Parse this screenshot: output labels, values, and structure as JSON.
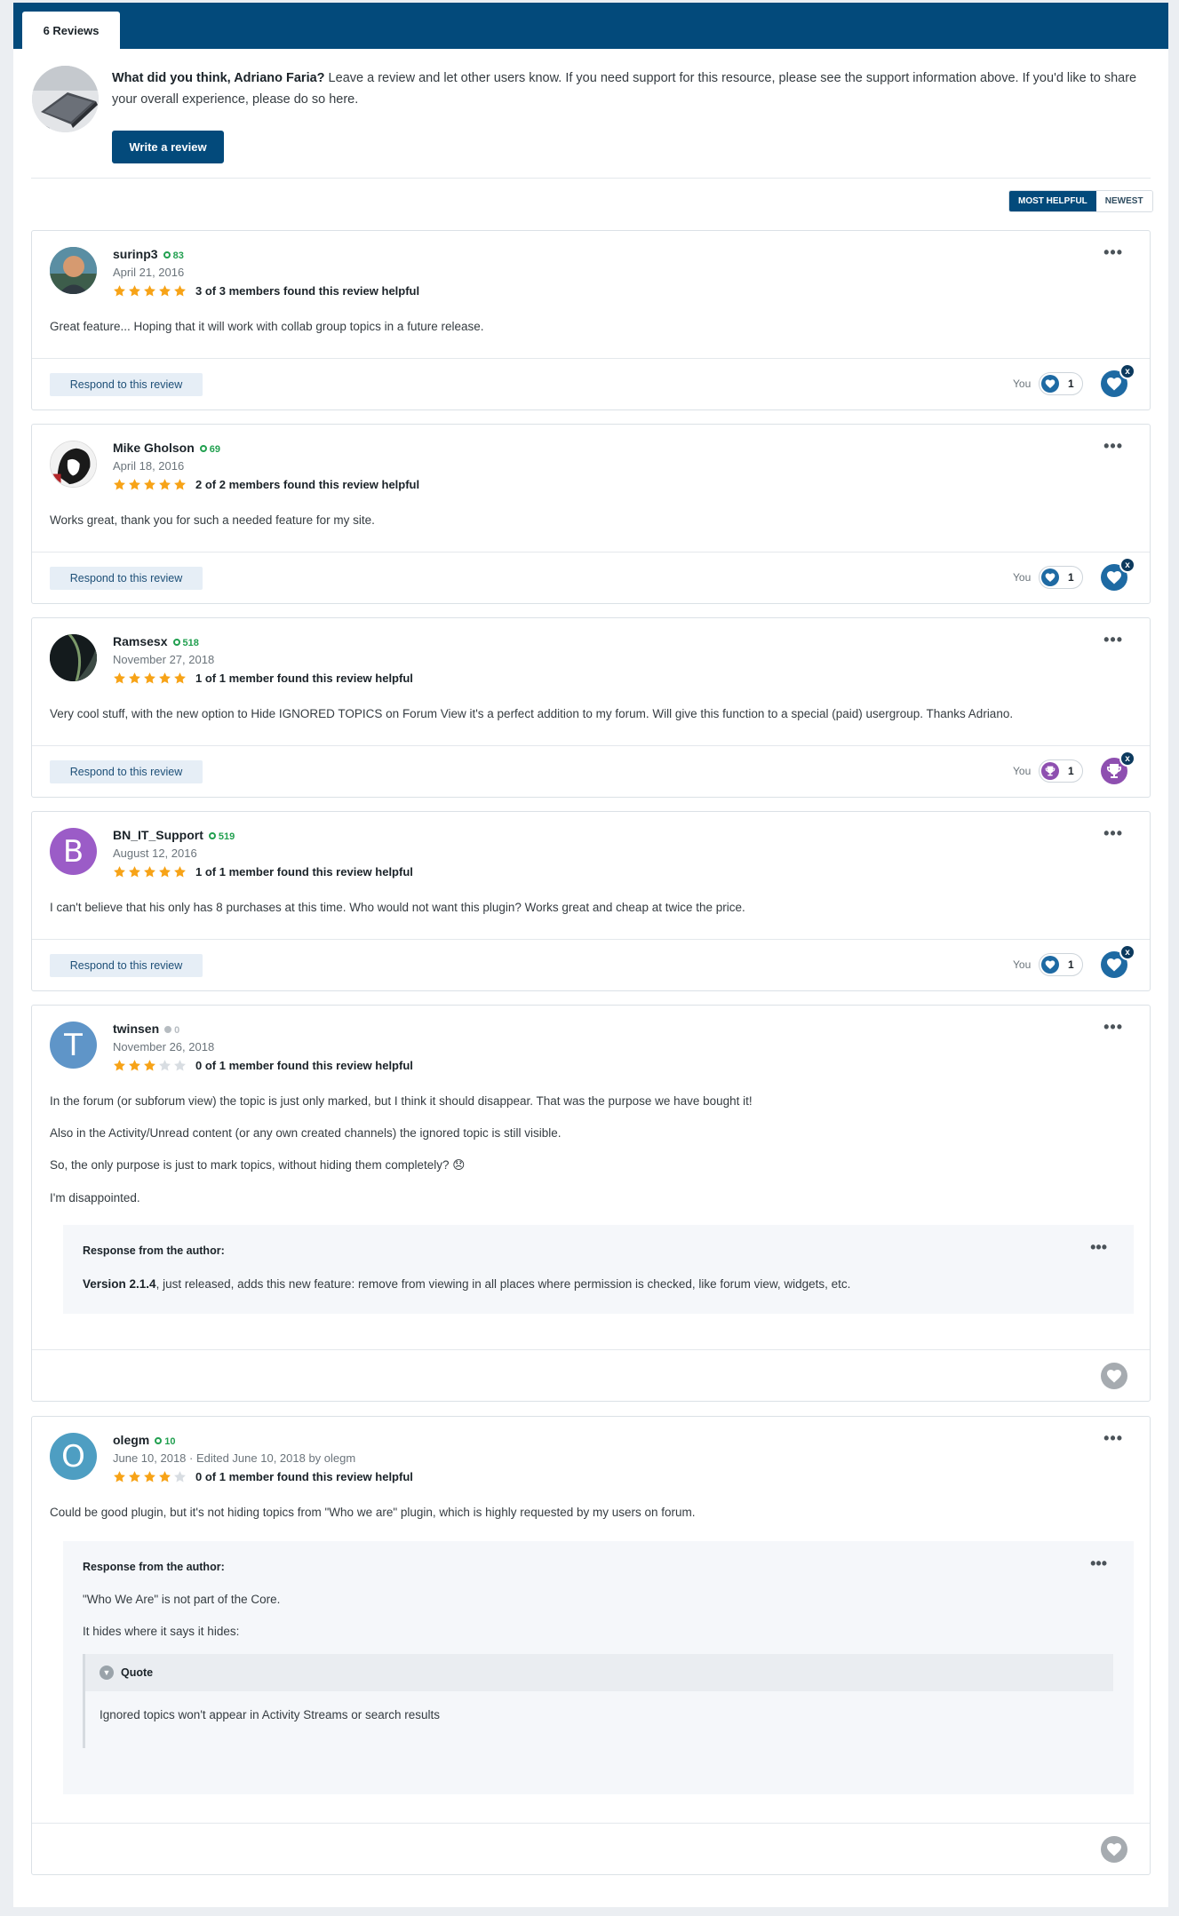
{
  "tab": {
    "label": "6 Reviews"
  },
  "intro": {
    "question": "What did you think, Adriano Faria?",
    "text": " Leave a review and let other users know. If you need support for this resource, please see the support information above. If you'd like to share your overall experience, please do so here.",
    "button": "Write a review"
  },
  "sort": {
    "most_helpful": "Most Helpful",
    "newest": "Newest"
  },
  "common": {
    "respond": "Respond to this review",
    "you": "You",
    "menu": "•••",
    "response_title": "Response from the author:",
    "remove_reaction": "x"
  },
  "reviews": [
    {
      "name": "surinp3",
      "rep": "83",
      "date": "April 21, 2016",
      "rating": 5,
      "helpful": "3 of 3 members found this review helpful",
      "text": "Great feature... Hoping that it will work with collab group topics in a future release.",
      "reaction_count": "1",
      "reaction": "heart"
    },
    {
      "name": "Mike Gholson",
      "rep": "69",
      "date": "April 18, 2016",
      "rating": 5,
      "helpful": "2 of 2 members found this review helpful",
      "text": "Works great, thank you for such a needed feature for my site.",
      "reaction_count": "1",
      "reaction": "heart"
    },
    {
      "name": "Ramsesx",
      "rep": "518",
      "date": "November 27, 2018",
      "rating": 5,
      "helpful": "1 of 1 member found this review helpful",
      "text": "Very cool stuff, with the new option to Hide IGNORED TOPICS on Forum View it's a perfect addition to my forum. Will give this function to a special (paid) usergroup. Thanks Adriano.",
      "reaction_count": "1",
      "reaction": "trophy"
    },
    {
      "name": "BN_IT_Support",
      "rep": "519",
      "date": "August 12, 2016",
      "rating": 5,
      "helpful": "1 of 1 member found this review helpful",
      "initial": "B",
      "text": "I can't believe that his only has 8 purchases at this time. Who would not want this plugin? Works great and cheap at twice the price.",
      "reaction_count": "1",
      "reaction": "heart"
    },
    {
      "name": "twinsen",
      "rep": "0",
      "date": "November 26, 2018",
      "rating": 3,
      "helpful": "0 of 1 member found this review helpful",
      "initial": "T",
      "paragraphs": [
        "In the forum (or subforum view) the topic is just only marked, but I think it should disappear. That was the purpose we have bought it!",
        "Also in the Activity/Unread content (or any own created channels) the ignored topic is still visible.",
        "So, the only purpose is just to mark topics, without hiding them completely? 😞",
        "I'm disappointed."
      ],
      "response_version": "Version 2.1.4",
      "response_text": ", just released, adds this new feature: remove from viewing in all places where permission is checked, like forum view, widgets, etc."
    },
    {
      "name": "olegm",
      "rep": "10",
      "date": "June 10, 2018 · Edited June 10, 2018 by olegm",
      "rating": 4,
      "helpful": "0 of 1 member found this review helpful",
      "initial": "O",
      "text": "Could be good plugin, but it's not hiding topics from  \"Who we are\" plugin, which is highly requested by my users on forum.",
      "response_p1": "\"Who We Are\" is not part of the Core.",
      "response_p2": "It hides where it says it hides:",
      "quote_label": "Quote",
      "quote_text": "Ignored topics won't appear in Activity Streams or search results"
    }
  ],
  "colors": {
    "brand": "#034a7b",
    "star": "#f7a317",
    "heart": "#1e6aa3",
    "trophy": "#8e4fb0",
    "rep": "#22a050"
  }
}
